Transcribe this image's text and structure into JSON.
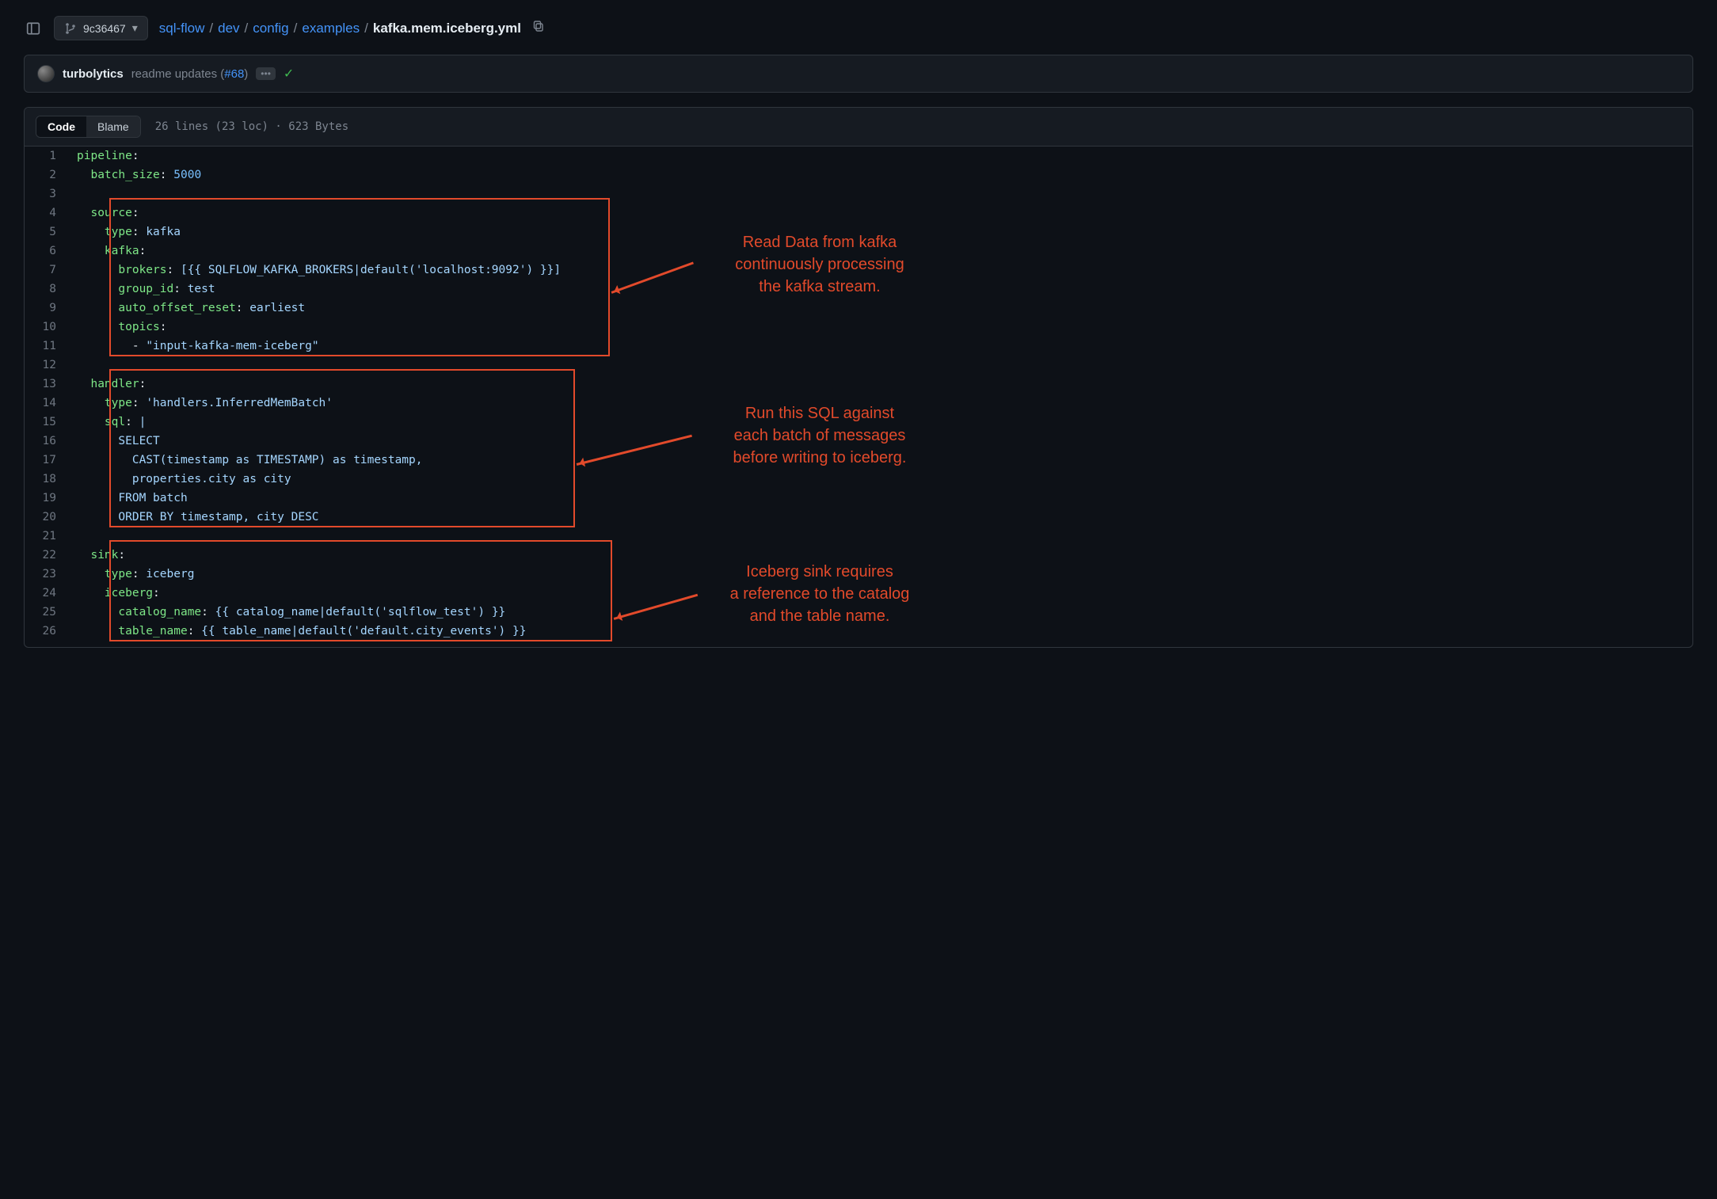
{
  "branch": "9c36467",
  "breadcrumb": {
    "repo": "sql-flow",
    "parts": [
      "dev",
      "config",
      "examples"
    ],
    "file": "kafka.mem.iceberg.yml"
  },
  "commit": {
    "author": "turbolytics",
    "message_prefix": "readme updates (",
    "pr": "#68",
    "message_suffix": ")"
  },
  "tabs": {
    "code": "Code",
    "blame": "Blame"
  },
  "file_info": "26 lines (23 loc) · 623 Bytes",
  "code_lines": [
    {
      "n": 1,
      "segs": [
        {
          "t": "k",
          "v": "pipeline"
        },
        {
          "t": "",
          "v": ":"
        }
      ]
    },
    {
      "n": 2,
      "segs": [
        {
          "t": "",
          "v": "  "
        },
        {
          "t": "k",
          "v": "batch_size"
        },
        {
          "t": "",
          "v": ": "
        },
        {
          "t": "n",
          "v": "5000"
        }
      ]
    },
    {
      "n": 3,
      "segs": []
    },
    {
      "n": 4,
      "segs": [
        {
          "t": "",
          "v": "  "
        },
        {
          "t": "k",
          "v": "source"
        },
        {
          "t": "",
          "v": ":"
        }
      ]
    },
    {
      "n": 5,
      "segs": [
        {
          "t": "",
          "v": "    "
        },
        {
          "t": "k",
          "v": "type"
        },
        {
          "t": "",
          "v": ": "
        },
        {
          "t": "s",
          "v": "kafka"
        }
      ]
    },
    {
      "n": 6,
      "segs": [
        {
          "t": "",
          "v": "    "
        },
        {
          "t": "k",
          "v": "kafka"
        },
        {
          "t": "",
          "v": ":"
        }
      ]
    },
    {
      "n": 7,
      "segs": [
        {
          "t": "",
          "v": "      "
        },
        {
          "t": "k",
          "v": "brokers"
        },
        {
          "t": "",
          "v": ": "
        },
        {
          "t": "s",
          "v": "[{{ SQLFLOW_KAFKA_BROKERS|default('localhost:9092') }}]"
        }
      ]
    },
    {
      "n": 8,
      "segs": [
        {
          "t": "",
          "v": "      "
        },
        {
          "t": "k",
          "v": "group_id"
        },
        {
          "t": "",
          "v": ": "
        },
        {
          "t": "s",
          "v": "test"
        }
      ]
    },
    {
      "n": 9,
      "segs": [
        {
          "t": "",
          "v": "      "
        },
        {
          "t": "k",
          "v": "auto_offset_reset"
        },
        {
          "t": "",
          "v": ": "
        },
        {
          "t": "s",
          "v": "earliest"
        }
      ]
    },
    {
      "n": 10,
      "segs": [
        {
          "t": "",
          "v": "      "
        },
        {
          "t": "k",
          "v": "topics"
        },
        {
          "t": "",
          "v": ":"
        }
      ]
    },
    {
      "n": 11,
      "segs": [
        {
          "t": "",
          "v": "        - "
        },
        {
          "t": "s",
          "v": "\"input-kafka-mem-iceberg\""
        }
      ]
    },
    {
      "n": 12,
      "segs": []
    },
    {
      "n": 13,
      "segs": [
        {
          "t": "",
          "v": "  "
        },
        {
          "t": "k",
          "v": "handler"
        },
        {
          "t": "",
          "v": ":"
        }
      ]
    },
    {
      "n": 14,
      "segs": [
        {
          "t": "",
          "v": "    "
        },
        {
          "t": "k",
          "v": "type"
        },
        {
          "t": "",
          "v": ": "
        },
        {
          "t": "s",
          "v": "'handlers.InferredMemBatch'"
        }
      ]
    },
    {
      "n": 15,
      "segs": [
        {
          "t": "",
          "v": "    "
        },
        {
          "t": "k",
          "v": "sql"
        },
        {
          "t": "",
          "v": ": "
        },
        {
          "t": "s",
          "v": "|"
        }
      ]
    },
    {
      "n": 16,
      "segs": [
        {
          "t": "s",
          "v": "      SELECT"
        }
      ]
    },
    {
      "n": 17,
      "segs": [
        {
          "t": "s",
          "v": "        CAST(timestamp as TIMESTAMP) as timestamp,"
        }
      ]
    },
    {
      "n": 18,
      "segs": [
        {
          "t": "s",
          "v": "        properties.city as city"
        }
      ]
    },
    {
      "n": 19,
      "segs": [
        {
          "t": "s",
          "v": "      FROM batch"
        }
      ]
    },
    {
      "n": 20,
      "segs": [
        {
          "t": "s",
          "v": "      ORDER BY timestamp, city DESC"
        }
      ]
    },
    {
      "n": 21,
      "segs": []
    },
    {
      "n": 22,
      "segs": [
        {
          "t": "",
          "v": "  "
        },
        {
          "t": "k",
          "v": "sink"
        },
        {
          "t": "",
          "v": ":"
        }
      ]
    },
    {
      "n": 23,
      "segs": [
        {
          "t": "",
          "v": "    "
        },
        {
          "t": "k",
          "v": "type"
        },
        {
          "t": "",
          "v": ": "
        },
        {
          "t": "s",
          "v": "iceberg"
        }
      ]
    },
    {
      "n": 24,
      "segs": [
        {
          "t": "",
          "v": "    "
        },
        {
          "t": "k",
          "v": "iceberg"
        },
        {
          "t": "",
          "v": ":"
        }
      ]
    },
    {
      "n": 25,
      "segs": [
        {
          "t": "",
          "v": "      "
        },
        {
          "t": "k",
          "v": "catalog_name"
        },
        {
          "t": "",
          "v": ": "
        },
        {
          "t": "s",
          "v": "{{ catalog_name|default('sqlflow_test') }}"
        }
      ]
    },
    {
      "n": 26,
      "segs": [
        {
          "t": "",
          "v": "      "
        },
        {
          "t": "k",
          "v": "table_name"
        },
        {
          "t": "",
          "v": ": "
        },
        {
          "t": "s",
          "v": "{{ table_name|default('default.city_events') }}"
        }
      ]
    }
  ],
  "annotations": {
    "a1": "Read Data from kafka\ncontinuously processing\nthe kafka stream.",
    "a2": "Run this SQL against\neach batch of messages\nbefore writing to iceberg.",
    "a3": "Iceberg sink requires\na reference to the catalog\nand the table name."
  }
}
